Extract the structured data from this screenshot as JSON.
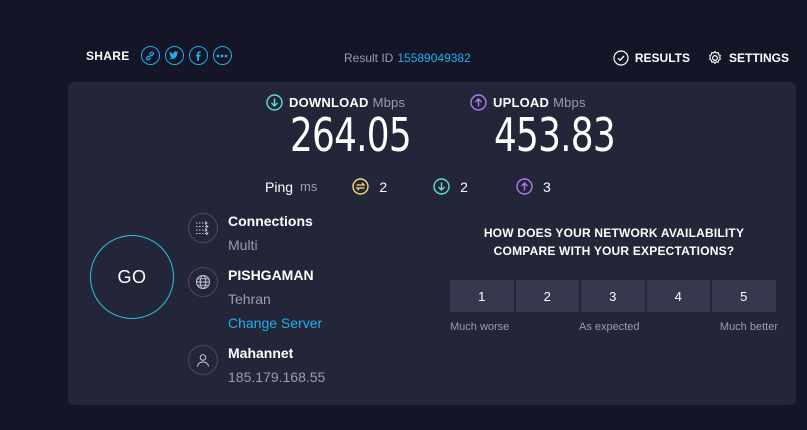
{
  "share": {
    "label": "SHARE",
    "icons": [
      "link-icon",
      "twitter-icon",
      "facebook-icon",
      "more-icon"
    ]
  },
  "result": {
    "label": "Result ID",
    "id": "15589049382"
  },
  "nav": {
    "results_label": "RESULTS",
    "settings_label": "SETTINGS"
  },
  "download": {
    "label": "DOWNLOAD",
    "unit": "Mbps",
    "value": "264.05"
  },
  "upload": {
    "label": "UPLOAD",
    "unit": "Mbps",
    "value": "453.83"
  },
  "ping": {
    "label": "Ping",
    "unit": "ms",
    "idle": "2",
    "download": "2",
    "upload": "3"
  },
  "go_label": "GO",
  "connections": {
    "title": "Connections",
    "value": "Multi"
  },
  "server": {
    "title": "PISHGAMAN",
    "location": "Tehran",
    "change_label": "Change Server"
  },
  "provider": {
    "title": "Mahannet",
    "ip": "185.179.168.55"
  },
  "survey": {
    "question_line1": "HOW DOES YOUR NETWORK AVAILABILITY",
    "question_line2": "COMPARE WITH YOUR EXPECTATIONS?",
    "options": [
      "1",
      "2",
      "3",
      "4",
      "5"
    ],
    "scale_low": "Much worse",
    "scale_mid": "As expected",
    "scale_high": "Much better"
  },
  "colors": {
    "accent_blue": "#1fb0ee",
    "download": "#5ee0d5",
    "upload": "#b27bf0",
    "ping_idle": "#f2dc6a",
    "background": "#141526",
    "card": "#232538"
  }
}
